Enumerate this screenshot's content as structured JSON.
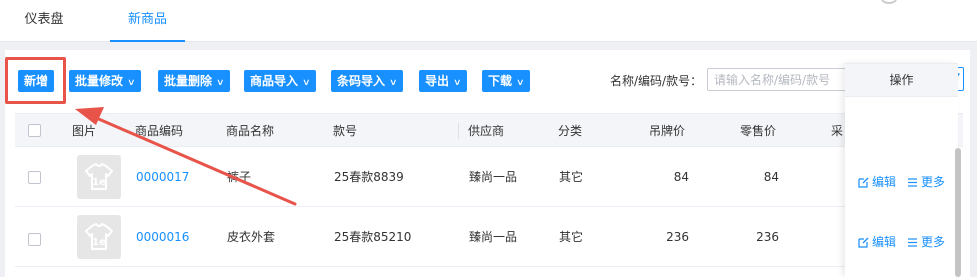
{
  "tabs": [
    {
      "label": "仪表盘",
      "active": false
    },
    {
      "label": "新商品",
      "active": true
    }
  ],
  "toolbar": {
    "buttons": [
      {
        "label": "新增"
      },
      {
        "label": "批量修改"
      },
      {
        "label": "批量删除"
      },
      {
        "label": "商品导入"
      },
      {
        "label": "条码导入"
      },
      {
        "label": "导出"
      },
      {
        "label": "下载"
      }
    ],
    "search_label": "名称/编码/款号：",
    "search_placeholder": "请输入名称/编码/款号"
  },
  "table": {
    "columns": [
      "图片",
      "商品编码",
      "商品名称",
      "款号",
      "供应商",
      "分类",
      "吊牌价",
      "零售价",
      "采",
      "操作"
    ],
    "rows": [
      {
        "code": "0000017",
        "name": "裤子",
        "style": "25春款8839",
        "supplier": "臻尚一品",
        "category": "其它",
        "tag_price": "84",
        "retail_price": "84"
      },
      {
        "code": "0000016",
        "name": "皮衣外套",
        "style": "25春款85210",
        "supplier": "臻尚一品",
        "category": "其它",
        "tag_price": "236",
        "retail_price": "236"
      }
    ],
    "actions": {
      "edit": "编辑",
      "more": "更多"
    }
  },
  "colors": {
    "accent": "#1890ff",
    "annotation": "#e8534a"
  },
  "icons": {
    "search": "search-icon",
    "filter": "filter-icon",
    "edit": "edit-icon",
    "more": "list-icon",
    "product": "tshirt-icon"
  }
}
